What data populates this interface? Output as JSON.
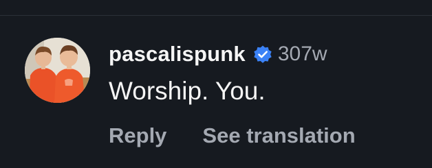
{
  "comment": {
    "username": "pascalispunk",
    "timestamp": "307w",
    "text": "Worship. You.",
    "verified_icon": "verified-badge-icon",
    "avatar": "profile-photo-avatar"
  },
  "actions": {
    "reply_label": "Reply",
    "translate_label": "See translation"
  },
  "colors": {
    "background": "#161a20",
    "primary_text": "#f5f5f5",
    "secondary_text": "#a4a9b2",
    "verified_blue": "#3b82f6"
  }
}
